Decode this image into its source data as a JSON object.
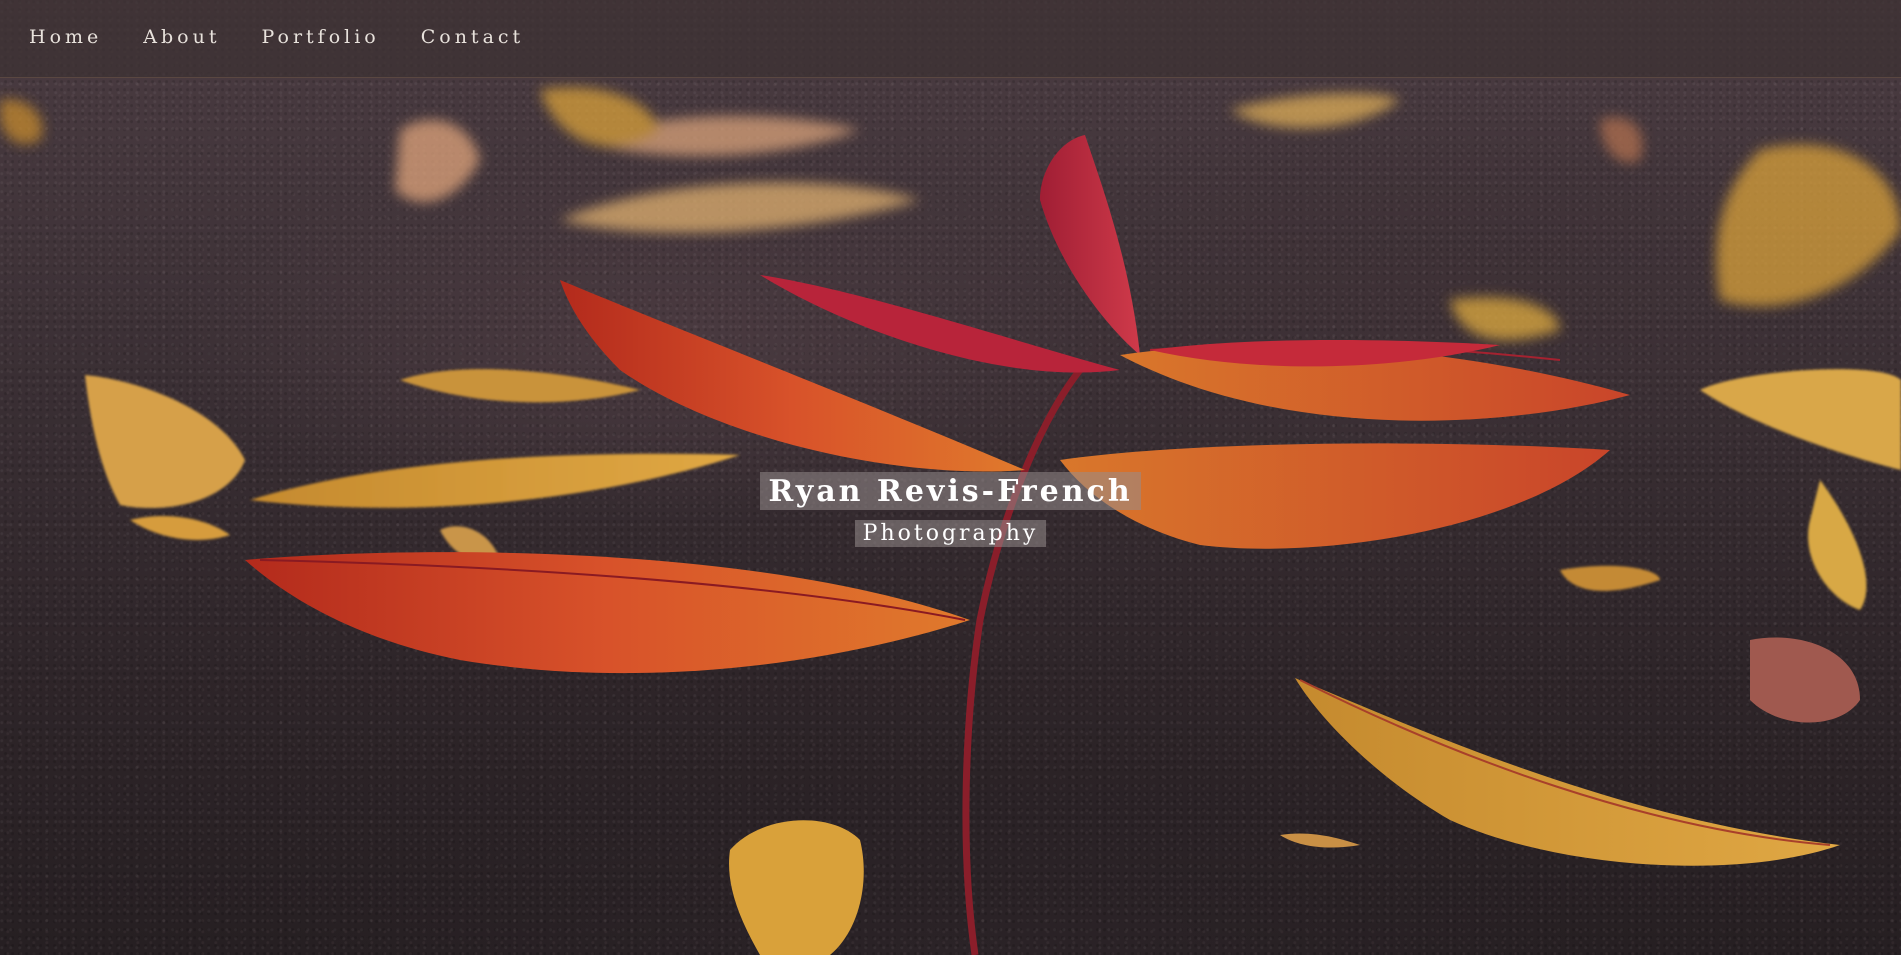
{
  "nav": {
    "items": [
      {
        "label": "Home"
      },
      {
        "label": "About"
      },
      {
        "label": "Portfolio"
      },
      {
        "label": "Contact"
      }
    ]
  },
  "hero": {
    "title": "Ryan Revis-French",
    "subtitle": "Photography"
  },
  "colors": {
    "background": "#2e2529",
    "nav_bar": "#3c3032",
    "leaf_red": "#c8341f",
    "leaf_orange": "#d9782c",
    "leaf_yellow": "#d8a13a",
    "leaf_crimson": "#b8243a"
  }
}
